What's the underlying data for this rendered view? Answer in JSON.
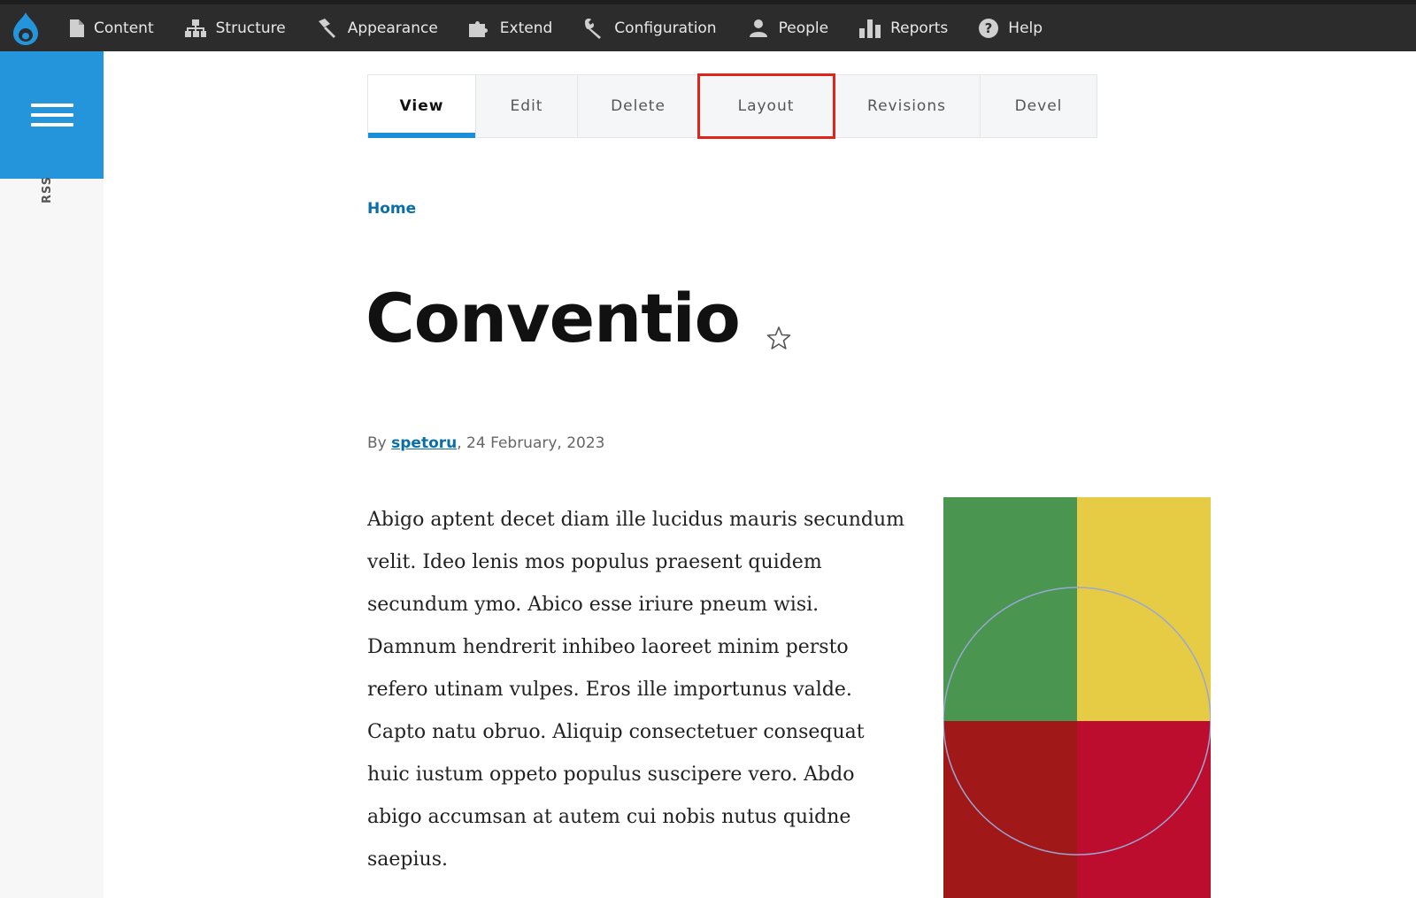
{
  "toolbar": {
    "items": [
      {
        "label": "Content",
        "icon": "file-icon"
      },
      {
        "label": "Structure",
        "icon": "sitemap-icon"
      },
      {
        "label": "Appearance",
        "icon": "paintbrush-icon"
      },
      {
        "label": "Extend",
        "icon": "puzzle-icon"
      },
      {
        "label": "Configuration",
        "icon": "wrench-icon"
      },
      {
        "label": "People",
        "icon": "people-icon"
      },
      {
        "label": "Reports",
        "icon": "bar-chart-icon"
      },
      {
        "label": "Help",
        "icon": "help-icon"
      }
    ]
  },
  "sidebar": {
    "rss_label": "RSS"
  },
  "tabs": [
    {
      "label": "View",
      "active": true
    },
    {
      "label": "Edit"
    },
    {
      "label": "Delete"
    },
    {
      "label": "Layout",
      "highlighted": true
    },
    {
      "label": "Revisions"
    },
    {
      "label": "Devel"
    }
  ],
  "breadcrumb": {
    "home": "Home"
  },
  "article": {
    "title": "Conventio",
    "byline_prefix": "By ",
    "author": "spetoru",
    "date": ", 24 February, 2023",
    "body": "Abigo aptent decet diam ille lucidus mauris secundum velit. Ideo lenis mos populus praesent quidem secundum ymo. Abico esse iriure pneum wisi. Damnum hendrerit inhibeo laoreet minim persto refero utinam vulpes. Eros ille importunus valde. Capto natu obruo. Aliquip consectetuer consequat huic iustum oppeto populus suscipere vero. Abdo abigo accumsan at autem cui nobis nutus quidne saepius."
  },
  "colors": {
    "toolbar_bg": "#2c2c2c",
    "accent_blue": "#2494db",
    "link_blue": "#0a6ea8",
    "highlight_red": "#e0241b",
    "art_green": "#4a9650",
    "art_yellow": "#e6cb45",
    "art_darkred": "#a01818",
    "art_red": "#bc0d2e"
  }
}
